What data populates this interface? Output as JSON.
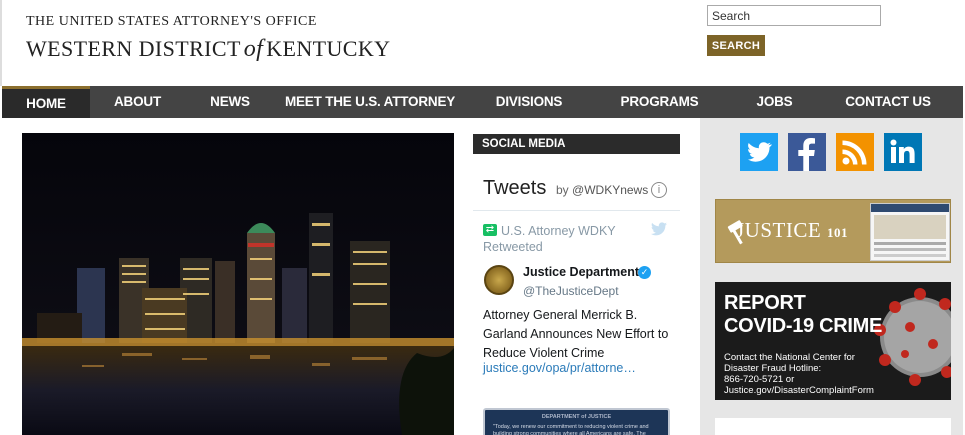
{
  "header": {
    "logo_line1": "THE UNITED STATES ATTORNEY'S OFFICE",
    "logo_line2_before": "WESTERN DISTRICT",
    "logo_line2_of": "of",
    "logo_line2_after": "KENTUCKY"
  },
  "search": {
    "placeholder": "Search",
    "button_label": "SEARCH",
    "button_color": "#7d6428"
  },
  "nav": {
    "items": [
      {
        "label": "HOME",
        "active": true
      },
      {
        "label": "ABOUT"
      },
      {
        "label": "NEWS"
      },
      {
        "label": "MEET THE U.S. ATTORNEY"
      },
      {
        "label": "DIVISIONS"
      },
      {
        "label": "PROGRAMS"
      },
      {
        "label": "JOBS"
      },
      {
        "label": "CONTACT US"
      }
    ]
  },
  "social": {
    "header": "SOCIAL MEDIA",
    "tweets_title": "Tweets",
    "tweets_by": "by",
    "tweets_handle": "@WDKYnews",
    "retweet_text": "U.S. Attorney WDKY Retweeted",
    "author_name": "Justice Department",
    "author_handle": "@TheJusticeDept",
    "tweet_body": "Attorney General Merrick B. Garland Announces New Effort to Reduce Violent Crime",
    "tweet_link": "justice.gov/opa/pr/attorne…",
    "card_header": "DEPARTMENT of JUSTICE",
    "card_text": "\"Today, we renew our commitment to reducing violent crime and building strong communities where all Americans are safe. The"
  },
  "right": {
    "social_icons": [
      {
        "icon": "twitter-icon",
        "color": "#1da1f2"
      },
      {
        "icon": "facebook-icon",
        "color": "#3b5998"
      },
      {
        "icon": "rss-icon",
        "color": "#f39200"
      },
      {
        "icon": "linkedin-icon",
        "color": "#0077b5"
      }
    ],
    "justice_title": "JUSTICE",
    "justice_num": "101",
    "covid_title_1": "REPORT",
    "covid_title_2": "COVID-19 CRIME",
    "covid_line1": "Contact the National Center for",
    "covid_line2": "Disaster Fraud Hotline:",
    "covid_line3": "866-720-5721 or",
    "covid_line4": "Justice.gov/DisasterComplaintForm"
  }
}
